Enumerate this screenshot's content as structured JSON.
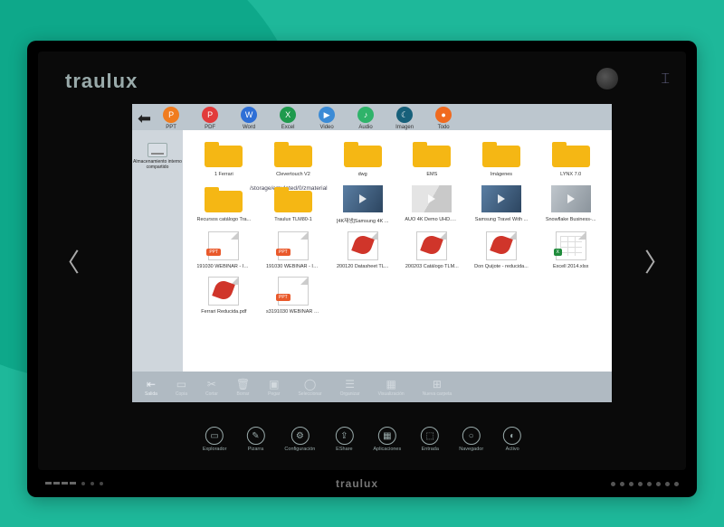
{
  "brand": "traulux",
  "path": "/storage/emulated/0/zmaterial",
  "filters": [
    {
      "label": "PPT",
      "color": "#f07c1f",
      "glyph": "P"
    },
    {
      "label": "PDF",
      "color": "#e23b3b",
      "glyph": "P"
    },
    {
      "label": "Word",
      "color": "#2e6fd6",
      "glyph": "W"
    },
    {
      "label": "Excel",
      "color": "#1f9a4d",
      "glyph": "X"
    },
    {
      "label": "Video",
      "color": "#3b8bd6",
      "glyph": "▶"
    },
    {
      "label": "Audio",
      "color": "#2fb36a",
      "glyph": "♪"
    },
    {
      "label": "Imagen",
      "color": "#17607a",
      "glyph": "☾"
    },
    {
      "label": "Todo",
      "color": "#f06a1f",
      "glyph": "●"
    }
  ],
  "drive_label": "Almacenamiento interno compartido",
  "items": [
    {
      "name": "1 Ferrari",
      "kind": "folder"
    },
    {
      "name": "Clevertouch V2",
      "kind": "folder"
    },
    {
      "name": "dwg",
      "kind": "folder"
    },
    {
      "name": "EMS",
      "kind": "folder"
    },
    {
      "name": "Imágenes",
      "kind": "folder"
    },
    {
      "name": "LYNX 7.0",
      "kind": "folder"
    },
    {
      "name": "Recursos catálogo Tra...",
      "kind": "folder"
    },
    {
      "name": "Traulux TLM80-1",
      "kind": "folder"
    },
    {
      "name": "[4K재생]Samsung 4K ...",
      "kind": "video",
      "variant": "var3"
    },
    {
      "name": "AUO 4K Demo UHD.mp4",
      "kind": "video",
      "variant": "var2"
    },
    {
      "name": "Samsung Travel With ...",
      "kind": "video",
      "variant": "var3"
    },
    {
      "name": "Snowflake Business-...",
      "kind": "video",
      "variant": "var4"
    },
    {
      "name": "191030 WEBINAR - IN...",
      "kind": "ppt"
    },
    {
      "name": "191030 WEBINAR - IN...",
      "kind": "ppt"
    },
    {
      "name": "200120 Datasheet TL...",
      "kind": "pdf"
    },
    {
      "name": "200203 Catálogo TLM...",
      "kind": "pdf"
    },
    {
      "name": "Don Quijote - reducida...",
      "kind": "pdf"
    },
    {
      "name": "Excell 2014.xlsx",
      "kind": "xls"
    },
    {
      "name": "Ferrari Reducida.pdf",
      "kind": "pdf"
    },
    {
      "name": "s3191030 WEBINAR - ...",
      "kind": "ppt"
    }
  ],
  "actions": [
    {
      "label": "Salida",
      "glyph": "⇤",
      "active": true
    },
    {
      "label": "Copia",
      "glyph": "▭"
    },
    {
      "label": "Cortar",
      "glyph": "✂"
    },
    {
      "label": "Borrar",
      "glyph": "🗑"
    },
    {
      "label": "Pegar",
      "glyph": "▣"
    },
    {
      "label": "Seleccionar",
      "glyph": "◯"
    },
    {
      "label": "Organizar",
      "glyph": "☰"
    },
    {
      "label": "Visualización",
      "glyph": "▦"
    },
    {
      "label": "Nueva carpeta",
      "glyph": "⊞"
    }
  ],
  "dock": [
    {
      "label": "Explorador",
      "glyph": "▭"
    },
    {
      "label": "Pizarra",
      "glyph": "✎"
    },
    {
      "label": "Configuración",
      "glyph": "⚙"
    },
    {
      "label": "EShare",
      "glyph": "⇪"
    },
    {
      "label": "Aplicaciones",
      "glyph": "▦"
    },
    {
      "label": "Entrada",
      "glyph": "⬚"
    },
    {
      "label": "Navegador",
      "glyph": "○"
    },
    {
      "label": "Activo",
      "glyph": "◐"
    }
  ]
}
